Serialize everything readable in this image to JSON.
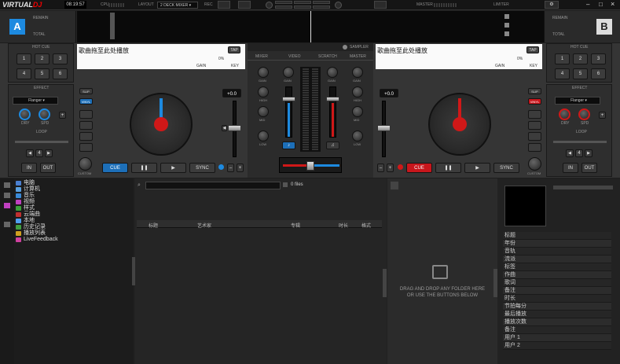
{
  "app": {
    "logo_a": "VIRTUAL",
    "logo_b": "DJ",
    "clock": "08:19:57",
    "cpu": "CPU",
    "layout_label": "LAYOUT",
    "layout_value": "2 DECK MIXER",
    "rec": "REC",
    "master": "MASTER",
    "limiter": "LIMITER"
  },
  "deckA": {
    "letter": "A",
    "remain": "REMAIN",
    "total": "TOTAL",
    "hotcue": "HOT CUE",
    "pads": [
      "1",
      "2",
      "3",
      "4",
      "5",
      "6"
    ],
    "effect": "EFFECT",
    "effect_value": "Flanger",
    "knob1": "DRY",
    "knob2": "SPD",
    "loop": "LOOP",
    "in": "IN",
    "out": "OUT",
    "title": "歌曲拖至此处播放",
    "tap": "TAP",
    "pitch_pct": "0%",
    "gain": "GAIN",
    "key": "KEY",
    "slip": "SLIP",
    "vinyl": "VINYL",
    "pitch_val": "+0.0",
    "master_tempo": "CUSTOM",
    "cue": "CUE",
    "play": "▶",
    "sync": "SYNC"
  },
  "deckB": {
    "letter": "B",
    "remain": "REMAIN",
    "total": "TOTAL",
    "hotcue": "HOT CUE",
    "pads": [
      "1",
      "2",
      "3",
      "4",
      "5",
      "6"
    ],
    "effect": "EFFECT",
    "effect_value": "Flanger",
    "knob1": "DRY",
    "knob2": "SPD",
    "loop": "LOOP",
    "in": "IN",
    "out": "OUT",
    "title": "歌曲拖至此处播放",
    "tap": "TAP",
    "pitch_pct": "0%",
    "gain": "GAIN",
    "key": "KEY",
    "slip": "SLIP",
    "vinyl": "VINYL",
    "pitch_val": "+0.0",
    "master_tempo": "CUSTOM",
    "cue": "CUE",
    "play": "▶",
    "sync": "SYNC"
  },
  "mixer": {
    "tabs": [
      "MIXER",
      "VIDEO",
      "SCRATCH",
      "MASTER"
    ],
    "sampler": "SAMPLER",
    "gain": "GAIN",
    "hi": "HIGH",
    "mid": "MID",
    "low": "LOW",
    "filter": "FILTER"
  },
  "browser": {
    "tree": [
      {
        "label": "电脑",
        "color": "#4a7fd0"
      },
      {
        "label": "计算机",
        "color": "#5aa0e0"
      },
      {
        "label": "音乐",
        "color": "#3a8ad8"
      },
      {
        "label": "视频",
        "color": "#c040c0"
      },
      {
        "label": "样式",
        "color": "#3aa03a"
      },
      {
        "label": "云端曲",
        "color": "#c03030"
      },
      {
        "label": "本地",
        "color": "#50a0f0"
      },
      {
        "label": "历史记录",
        "color": "#40a040"
      },
      {
        "label": "播放列表",
        "color": "#d0a020"
      },
      {
        "label": "LiveFeedback",
        "color": "#d040a0"
      }
    ],
    "search_placeholder": "",
    "file_count": "0 files",
    "columns": [
      "标题",
      "艺术家",
      "专辑",
      "时长",
      "格式"
    ],
    "drop_line1": "DRAG AND DROP ANY FOLDER HERE",
    "drop_line2": "OR USE THE BUTTONS BELOW",
    "info_rows": [
      "标题",
      "年份",
      "音轨",
      "流派",
      "标签",
      "作曲",
      "歌词",
      "备注",
      "时长",
      "节拍每分",
      "最后播放",
      "播放次数",
      "备注",
      "用户 1",
      "用户 2"
    ]
  }
}
